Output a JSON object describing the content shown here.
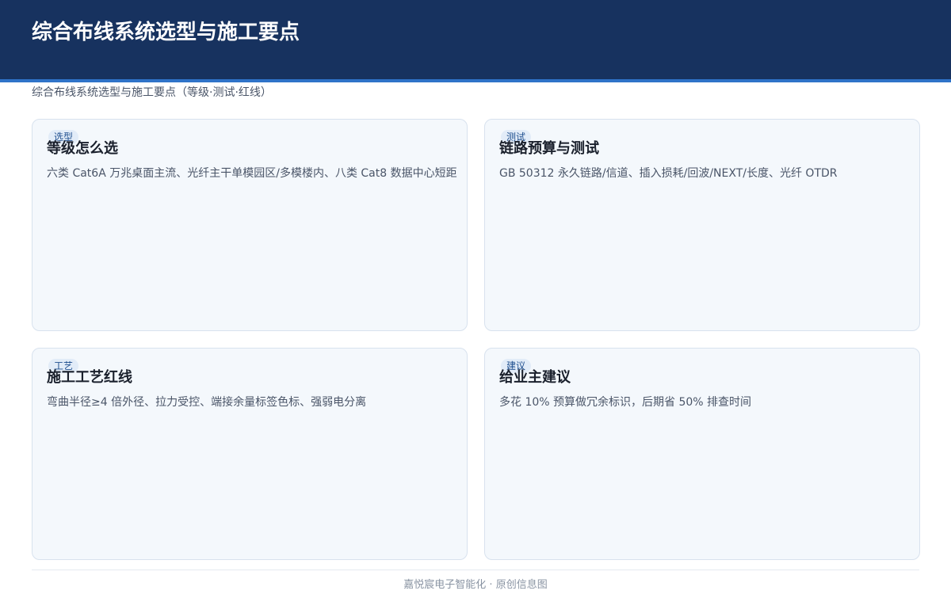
{
  "header": {
    "title": "综合布线系统选型与施工要点"
  },
  "subtitle": "综合布线系统选型与施工要点（等级·测试·红线）",
  "cards": [
    {
      "tag": "选型",
      "title": "等级怎么选",
      "body": "六类 Cat6A 万兆桌面主流、光纤主干单模园区/多模楼内、八类 Cat8 数据中心短距"
    },
    {
      "tag": "测试",
      "title": "链路预算与测试",
      "body": "GB 50312 永久链路/信道、插入损耗/回波/NEXT/长度、光纤 OTDR"
    },
    {
      "tag": "工艺",
      "title": "施工工艺红线",
      "body": "弯曲半径≥4 倍外径、拉力受控、端接余量标签色标、强弱电分离"
    },
    {
      "tag": "建议",
      "title": "给业主建议",
      "body": "多花 10% 预算做冗余标识，后期省 50% 排查时间"
    }
  ],
  "footer": "嘉悦宸电子智能化 · 原创信息图",
  "colors": {
    "header_bg": "#17325f",
    "header_accent": "#2f73c8",
    "card_bg": "#f4f8fc",
    "tag_bg": "#e2ecf8",
    "tag_text": "#1f4f8f"
  }
}
